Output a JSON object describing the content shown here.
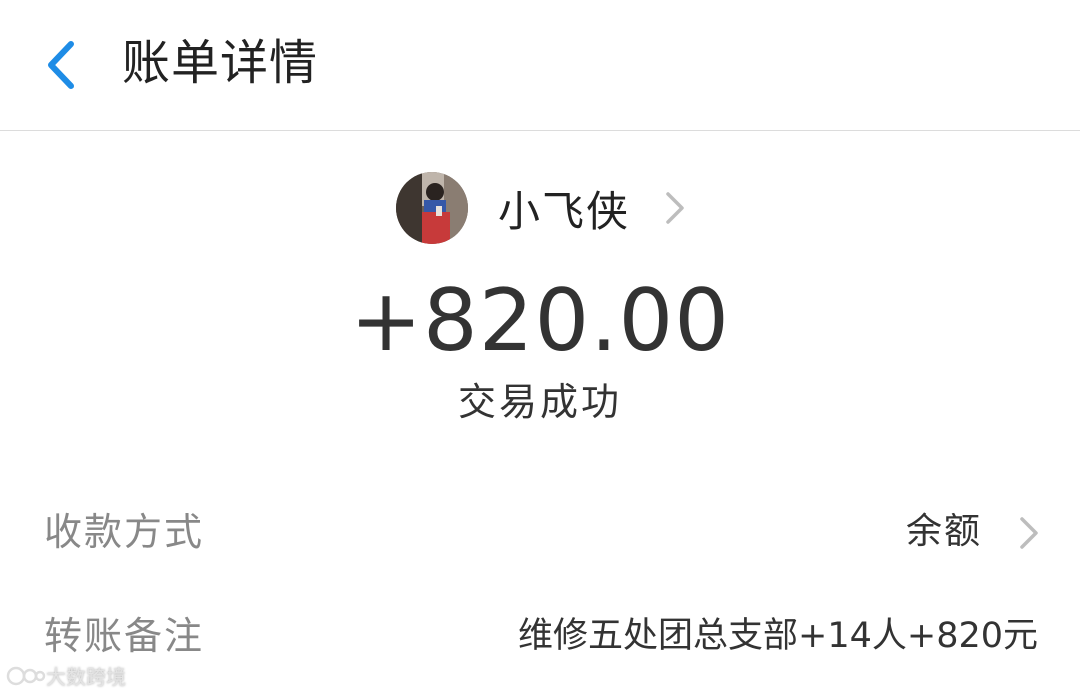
{
  "header": {
    "title": "账单详情",
    "back_icon": "chevron-left-icon",
    "accent_color": "#1e8ce6"
  },
  "payee": {
    "name": "小飞侠",
    "avatar": "user-avatar-photo",
    "chevron_icon": "chevron-right-icon"
  },
  "transaction": {
    "amount": "+820.00",
    "status": "交易成功"
  },
  "details": [
    {
      "label": "收款方式",
      "value": "余额",
      "has_chevron": true
    },
    {
      "label": "转账备注",
      "value": "维修五处团总支部+14人+820元",
      "has_chevron": false
    }
  ],
  "watermark": {
    "text": "大数跨境"
  }
}
